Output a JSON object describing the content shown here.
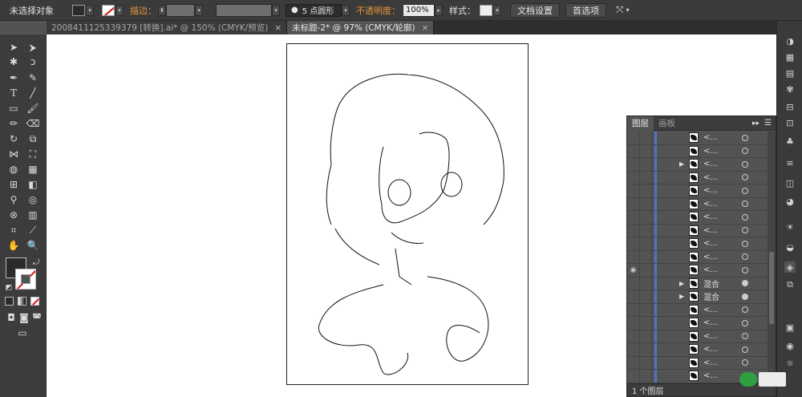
{
  "control_bar": {
    "selection_status": "未选择对象",
    "stroke_label": "描边：",
    "brush_label": "5 点圆形",
    "opacity_label": "不透明度：",
    "opacity_value": "100%",
    "style_label": "样式：",
    "doc_setup_button": "文档设置",
    "preferences_button": "首选项"
  },
  "tabs": [
    {
      "label": "2008411125339379 [转换].ai* @ 150% (CMYK/预览)",
      "close": "×"
    },
    {
      "label": "未标题-2* @ 97% (CMYK/轮廓)",
      "close": "×"
    }
  ],
  "layers_panel": {
    "tab_layers": "图层",
    "tab_artboards": "画板",
    "menu_icon": "▸▸",
    "rows": [
      {
        "name": "<...",
        "arrow": "",
        "thumb": "ribbon-icon",
        "eye": ""
      },
      {
        "name": "<...",
        "arrow": "",
        "thumb": "shape-icon",
        "eye": ""
      },
      {
        "name": "<...",
        "arrow": "▶",
        "thumb": "figure-icon",
        "eye": ""
      },
      {
        "name": "<...",
        "arrow": "",
        "thumb": "shape-icon",
        "eye": ""
      },
      {
        "name": "<...",
        "arrow": "",
        "thumb": "shape-icon",
        "eye": ""
      },
      {
        "name": "<...",
        "arrow": "",
        "thumb": "shape-icon",
        "eye": ""
      },
      {
        "name": "<...",
        "arrow": "",
        "thumb": "shape-icon",
        "eye": ""
      },
      {
        "name": "<...",
        "arrow": "",
        "thumb": "shape-icon",
        "eye": ""
      },
      {
        "name": "<...",
        "arrow": "",
        "thumb": "shape-icon",
        "eye": ""
      },
      {
        "name": "<...",
        "arrow": "",
        "thumb": "shape-icon",
        "eye": ""
      },
      {
        "name": "<...",
        "arrow": "",
        "thumb": "figure-icon",
        "eye": "◉"
      },
      {
        "name": "混合",
        "arrow": "▶",
        "thumb": "shape-icon",
        "eye": ""
      },
      {
        "name": "混合",
        "arrow": "▶",
        "thumb": "shape-icon",
        "eye": ""
      },
      {
        "name": "<...",
        "arrow": "",
        "thumb": "shape-icon",
        "eye": ""
      },
      {
        "name": "<...",
        "arrow": "",
        "thumb": "shape-icon",
        "eye": ""
      },
      {
        "name": "<...",
        "arrow": "",
        "thumb": "shape-icon",
        "eye": ""
      },
      {
        "name": "<...",
        "arrow": "",
        "thumb": "shape-icon",
        "eye": ""
      },
      {
        "name": "<...",
        "arrow": "",
        "thumb": "shape-icon",
        "eye": ""
      },
      {
        "name": "<...",
        "arrow": "",
        "thumb": "shape-icon",
        "eye": ""
      }
    ],
    "footer_count": "1 个图层"
  },
  "colors": {
    "accent_orange": "#e8923a",
    "layer_bar_blue": "#4f74c9",
    "stroke_none_red": "#dd1111"
  }
}
